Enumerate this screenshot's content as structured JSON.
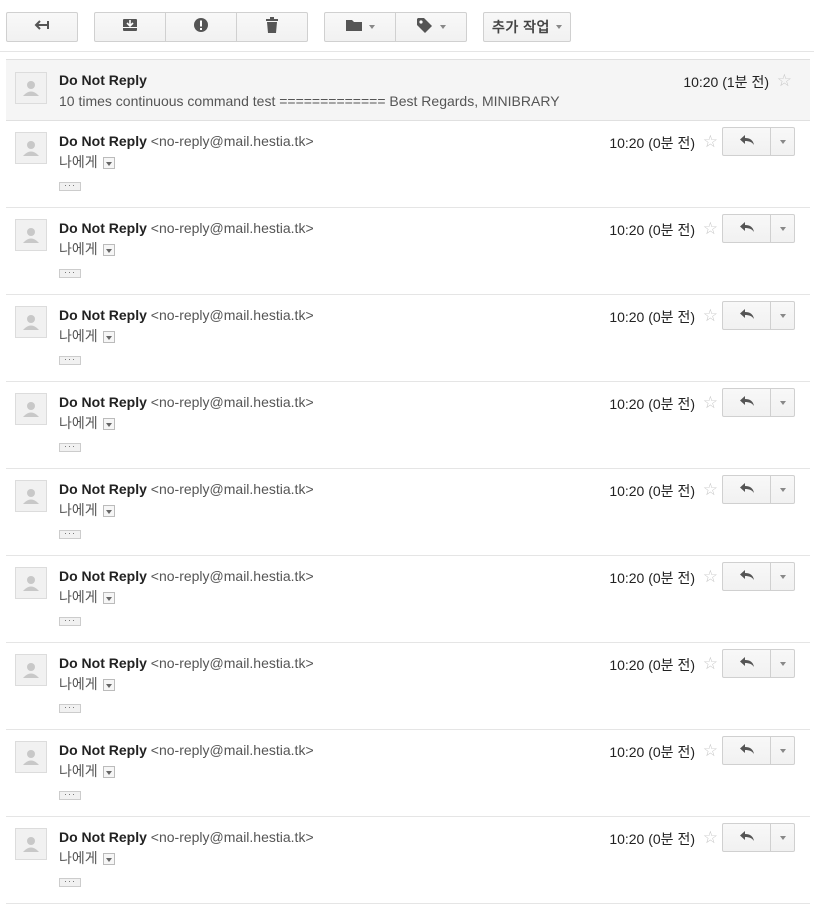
{
  "toolbar": {
    "back_icon": "back-arrow-icon",
    "archive_icon": "archive-icon",
    "spam_icon": "report-spam-icon",
    "delete_icon": "trash-icon",
    "move_icon": "folder-icon",
    "label_icon": "label-tag-icon",
    "more_label": "추가 작업"
  },
  "collapsed_message": {
    "sender": "Do Not Reply",
    "snippet": "10 times continuous command test ============= Best Regards, MINIBRARY",
    "time": "10:20 (1분 전)"
  },
  "messages": [
    {
      "sender": "Do Not Reply",
      "email": "<no-reply@mail.hestia.tk>",
      "to": "나에게",
      "time": "10:20 (0분 전)",
      "ellipsis": "···"
    },
    {
      "sender": "Do Not Reply",
      "email": "<no-reply@mail.hestia.tk>",
      "to": "나에게",
      "time": "10:20 (0분 전)",
      "ellipsis": "···"
    },
    {
      "sender": "Do Not Reply",
      "email": "<no-reply@mail.hestia.tk>",
      "to": "나에게",
      "time": "10:20 (0분 전)",
      "ellipsis": "···"
    },
    {
      "sender": "Do Not Reply",
      "email": "<no-reply@mail.hestia.tk>",
      "to": "나에게",
      "time": "10:20 (0분 전)",
      "ellipsis": "···"
    },
    {
      "sender": "Do Not Reply",
      "email": "<no-reply@mail.hestia.tk>",
      "to": "나에게",
      "time": "10:20 (0분 전)",
      "ellipsis": "···"
    },
    {
      "sender": "Do Not Reply",
      "email": "<no-reply@mail.hestia.tk>",
      "to": "나에게",
      "time": "10:20 (0분 전)",
      "ellipsis": "···"
    },
    {
      "sender": "Do Not Reply",
      "email": "<no-reply@mail.hestia.tk>",
      "to": "나에게",
      "time": "10:20 (0분 전)",
      "ellipsis": "···"
    },
    {
      "sender": "Do Not Reply",
      "email": "<no-reply@mail.hestia.tk>",
      "to": "나에게",
      "time": "10:20 (0분 전)",
      "ellipsis": "···"
    },
    {
      "sender": "Do Not Reply",
      "email": "<no-reply@mail.hestia.tk>",
      "to": "나에게",
      "time": "10:20 (0분 전)",
      "ellipsis": "···"
    }
  ],
  "colors": {
    "toolbar_bg": "#f5f5f5",
    "collapsed_bg": "#f5f5f5",
    "star": "#c6c6c6"
  }
}
